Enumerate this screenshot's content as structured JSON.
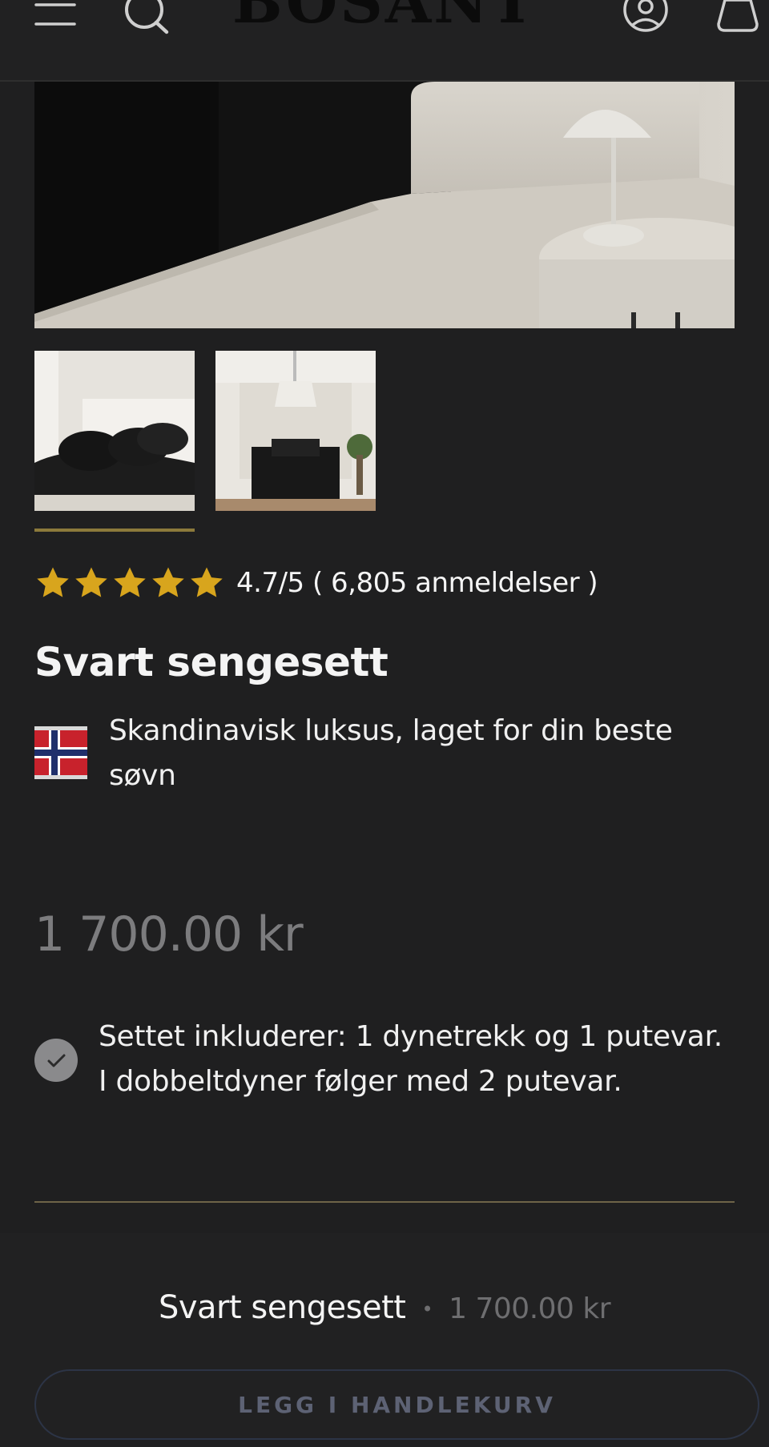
{
  "header": {
    "logo": "BOSANT",
    "icons": [
      "menu-icon",
      "search-icon",
      "account-icon",
      "cart-icon"
    ]
  },
  "gallery": {
    "thumbnails": [
      "thumbnail-1",
      "thumbnail-2"
    ],
    "active_index": 0
  },
  "rating": {
    "stars": 5,
    "text": "4.7/5 ( 6,805 anmeldelser )"
  },
  "product": {
    "title": "Svart sengesett",
    "tagline": "Skandinavisk luksus, laget for din beste søvn",
    "flag": "norway-flag-icon",
    "price": "1 700.00 kr",
    "includes": "Settet inkluderer: 1 dynetrekk og 1 putevar. I dobbeltdyner følger med 2 putevar."
  },
  "sticky_bar": {
    "title": "Svart sengesett",
    "separator": "•",
    "price": "1 700.00 kr",
    "button_label": "LEGG I HANDLEKURV"
  },
  "colors": {
    "background": "#1f1f20",
    "star": "#d8a51d",
    "price": "#7c7c7e",
    "divider": "#6e6448"
  }
}
